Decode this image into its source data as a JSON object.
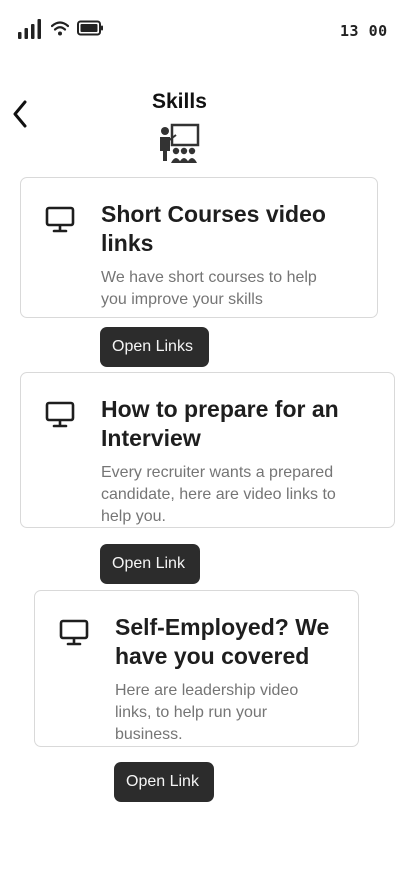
{
  "status_bar": {
    "time": "13 00"
  },
  "header": {
    "title": "Skills"
  },
  "cards": [
    {
      "title": "Short Courses video links",
      "description": "We have short courses to help you improve your skills",
      "button_label": "Open Links"
    },
    {
      "title": "How to prepare for an Interview",
      "description": "Every recruiter wants a prepared candidate, here are video links to help you.",
      "button_label": "Open Link"
    },
    {
      "title": "Self-Employed? We have you covered",
      "description": "Here are leadership video links, to help run your business.",
      "button_label": "Open Link"
    }
  ],
  "colors": {
    "button_bg": "#2c2c2c",
    "card_border": "#d9d9d9",
    "description_text": "#757575"
  }
}
